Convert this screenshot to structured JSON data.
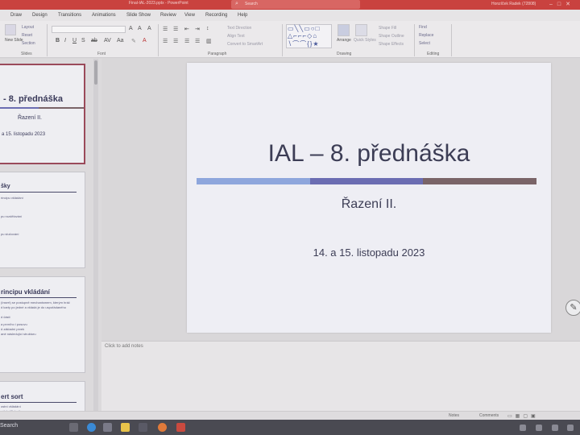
{
  "window": {
    "title": "Final-IAL-2023.pptx - PowerPoint",
    "search_placeholder": "Search",
    "user": "Honzíček Radek (72808)"
  },
  "menu": {
    "tabs": [
      "Draw",
      "Design",
      "Transitions",
      "Animations",
      "Slide Show",
      "Review",
      "View",
      "Recording",
      "Help"
    ]
  },
  "ribbon": {
    "slides": {
      "new_slide": "New Slide",
      "layout": "Layout",
      "reset": "Reset",
      "section": "Section",
      "label": "Slides"
    },
    "font": {
      "label": "Font"
    },
    "paragraph": {
      "text_direction": "Text Direction",
      "align_text": "Align Text",
      "convert_smartart": "Convert to SmartArt",
      "label": "Paragraph"
    },
    "drawing": {
      "arrange": "Arrange",
      "quick_styles": "Quick Styles",
      "shape_fill": "Shape Fill",
      "shape_outline": "Shape Outline",
      "shape_effects": "Shape Effects",
      "label": "Drawing"
    },
    "editing": {
      "find": "Find",
      "replace": "Replace",
      "select": "Select",
      "label": "Editing"
    }
  },
  "thumbnails": [
    {
      "title": "- 8. přednáška",
      "subtitle": "Řazení II.",
      "date": "a 15. listopadu 2023",
      "active": true
    },
    {
      "title": "šky",
      "lines": [
        "rincipu vkládání",
        "pu rozdělování",
        "pu slučování"
      ],
      "active": false
    },
    {
      "title": "rincipu vkládání",
      "lines": [
        "(Insert) se postupně mechanismem, kterým hráč",
        "d karty po jedné a vkládá je do uspořádaného",
        "d části",
        "a prvního i posuvu",
        "d základní prvek",
        "ané následující strukturu"
      ],
      "active": false
    },
    {
      "title": "ert sort",
      "lines": [
        "ostní vkládání",
        "výběr (Select)"
      ],
      "active": false
    }
  ],
  "slide": {
    "title": "IAL – 8. přednáška",
    "subtitle": "Řazení II.",
    "date": "14. a 15. listopadu 2023",
    "bar_colors": [
      "#8ea6dc",
      "#6b6db2",
      "#7a6468"
    ]
  },
  "notes": {
    "placeholder": "Click to add notes"
  },
  "status": {
    "notes": "Notes",
    "comments": "Comments"
  },
  "taskbar": {
    "search": "Search"
  }
}
